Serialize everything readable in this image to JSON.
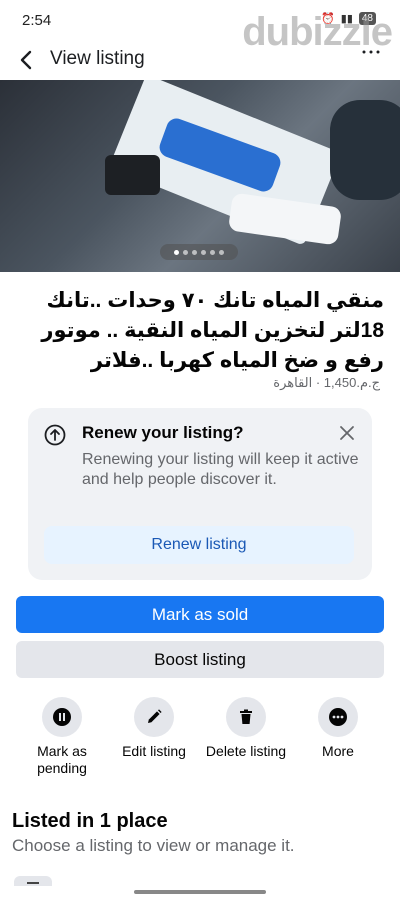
{
  "status": {
    "time": "2:54",
    "battery": "48"
  },
  "watermark": "dubizzle",
  "nav": {
    "title": "View listing"
  },
  "gallery": {
    "image_count": 6,
    "active_index": 0
  },
  "listing": {
    "title": "منقي المياه تانك ٧٠ وحدات ..تانك 18لتر لتخزين المياه النقية .. موتور رفع و ضخ المياه كهربا ..فلاتر",
    "price_location": "ج.م.1,450 · القاهرة"
  },
  "renew": {
    "title": "Renew your listing?",
    "description": "Renewing your listing will keep it active and help people discover it.",
    "button": "Renew listing"
  },
  "buttons": {
    "mark_sold": "Mark as sold",
    "boost": "Boost listing"
  },
  "actions": [
    {
      "label": "Mark as pending",
      "icon": "pause-icon"
    },
    {
      "label": "Edit listing",
      "icon": "pencil-icon"
    },
    {
      "label": "Delete listing",
      "icon": "trash-icon"
    },
    {
      "label": "More",
      "icon": "more-dots-icon"
    }
  ],
  "listed": {
    "title": "Listed in 1 place",
    "subtitle": "Choose a listing to view or manage it."
  },
  "colors": {
    "primary": "#1877f2",
    "renew_bg": "#e7f3ff",
    "card_bg": "#f0f2f5"
  }
}
